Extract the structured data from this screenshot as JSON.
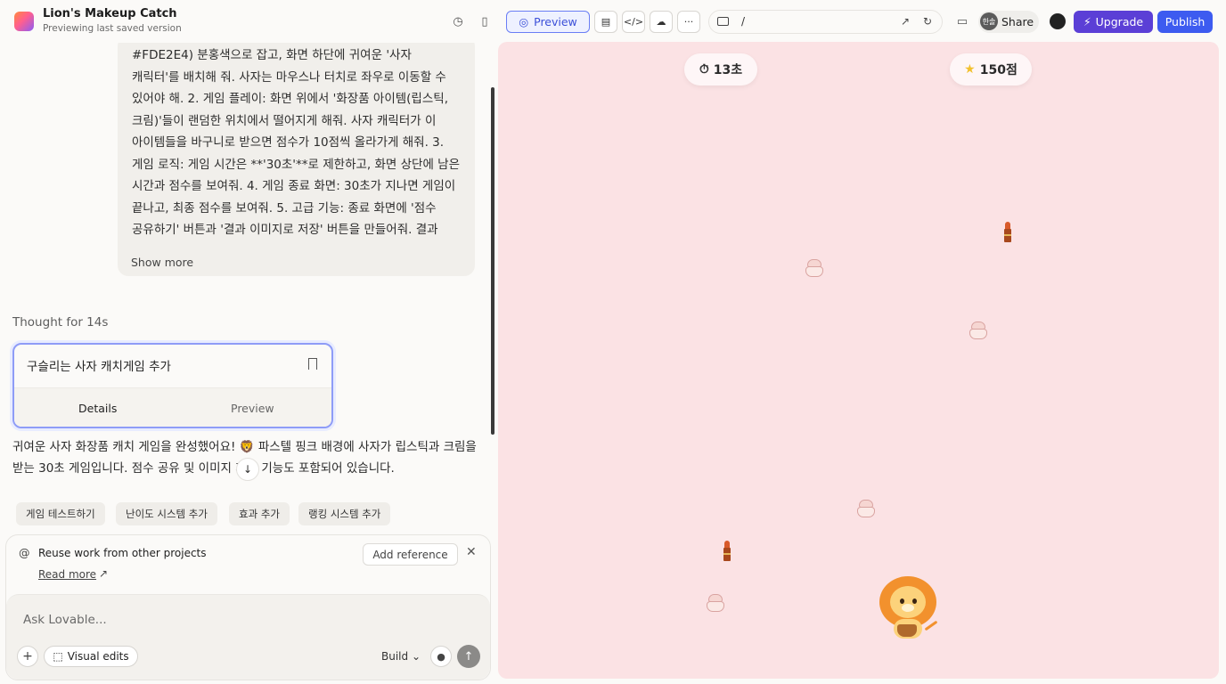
{
  "project": {
    "title": "Lion's Makeup Catch",
    "subtitle": "Previewing last saved version"
  },
  "toolbar": {
    "preview_label": "Preview",
    "url_path": "/",
    "share_label": "Share",
    "avatar_initials": "한솔",
    "upgrade_label": "Upgrade",
    "publish_label": "Publish"
  },
  "chat": {
    "user_message": "#FDE2E4) 분홍색으로 잡고, 화면 하단에 귀여운 '사자 캐릭터'를 배치해 줘. 사자는 마우스나 터치로 좌우로 이동할 수 있어야 해. 2. 게임 플레이: 화면 위에서 '화장품 아이템(립스틱, 크림)'들이 랜덤한 위치에서 떨어지게 해줘. 사자 캐릭터가 이 아이템들을 바구니로 받으면 점수가 10점씩 올라가게 해줘. 3. 게임 로직: 게임 시간은 **'30초'**로 제한하고, 화면 상단에 남은 시간과 점수를 보여줘. 4. 게임 종료 화면: 30초가 지나면 게임이 끝나고, 최종 점수를 보여줘. 5. 고급 기능: 종료 화면에 '점수 공유하기' 버튼과 '결과 이미지로 저장' 버튼을 만들어줘. 결과 이미지는 현재 점수 화면을 캡처해서 PNG 파일로 다운로 ...",
    "show_more": "Show more",
    "thought": "Thought for 14s",
    "card": {
      "title": "구슬리는 사자 캐치게임 추가",
      "tab_details": "Details",
      "tab_preview": "Preview"
    },
    "reply": "귀여운 사자 화장품 캐치 게임을 완성했어요! 🦁 파스텔 핑크 배경에 사자가 립스틱과 크림을 받는 30초 게임입니다. 점수 공유 및 이미지 저장 기능도 포함되어 있습니다.",
    "suggestions": [
      "게임 테스트하기",
      "난이도 시스템 추가",
      "효과 추가",
      "랭킹 시스템 추가"
    ]
  },
  "reference": {
    "title": "Reuse work from other projects",
    "read_more": "Read more",
    "add_label": "Add reference"
  },
  "composer": {
    "placeholder": "Ask Lovable...",
    "visual_edits": "Visual edits",
    "mode": "Build"
  },
  "game": {
    "timer_text": "13초",
    "score_text": "150점",
    "background": "#FDE2E4"
  },
  "colors": {
    "upgrade": "#5b3fd6",
    "publish": "#3d5bf0",
    "preview_accent": "#3b4fd8"
  }
}
